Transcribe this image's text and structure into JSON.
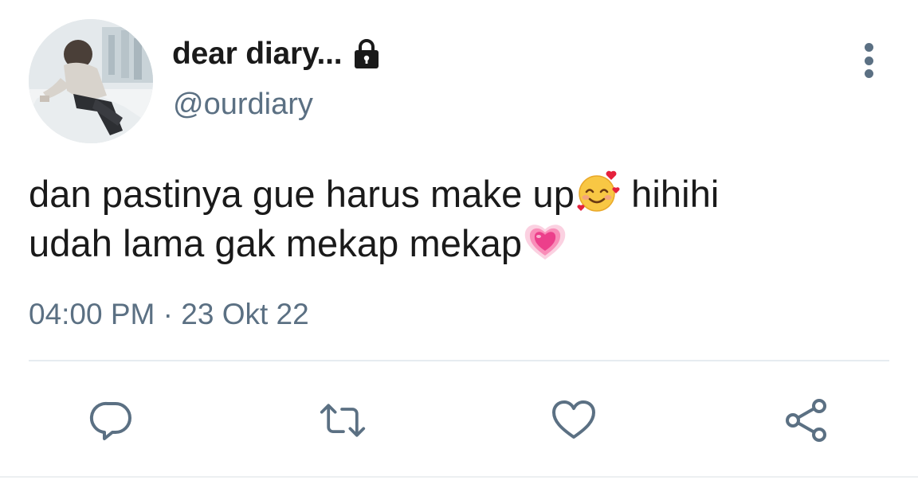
{
  "user": {
    "display_name": "dear diary...",
    "handle": "@ourdiary",
    "protected_icon": "lock-icon",
    "avatar": "profile-photo"
  },
  "tweet": {
    "line1_part1": "dan pastinya gue harus make up",
    "line1_emoji": "smiling-face-with-hearts-emoji",
    "line1_part2": " hihihi",
    "line2_part1": "udah lama gak mekap mekap",
    "line2_emoji": "growing-heart-emoji"
  },
  "meta": {
    "time": "04:00 PM",
    "separator": " · ",
    "date": "23 Okt 22"
  },
  "actions": {
    "reply": "reply-icon",
    "retweet": "retweet-icon",
    "like": "heart-icon",
    "share": "share-icon"
  },
  "more_menu": "more-vertical-icon",
  "colors": {
    "text": "#1a1a1a",
    "secondary": "#5b7083",
    "divider": "#e6ecf0",
    "background": "#ffffff"
  }
}
